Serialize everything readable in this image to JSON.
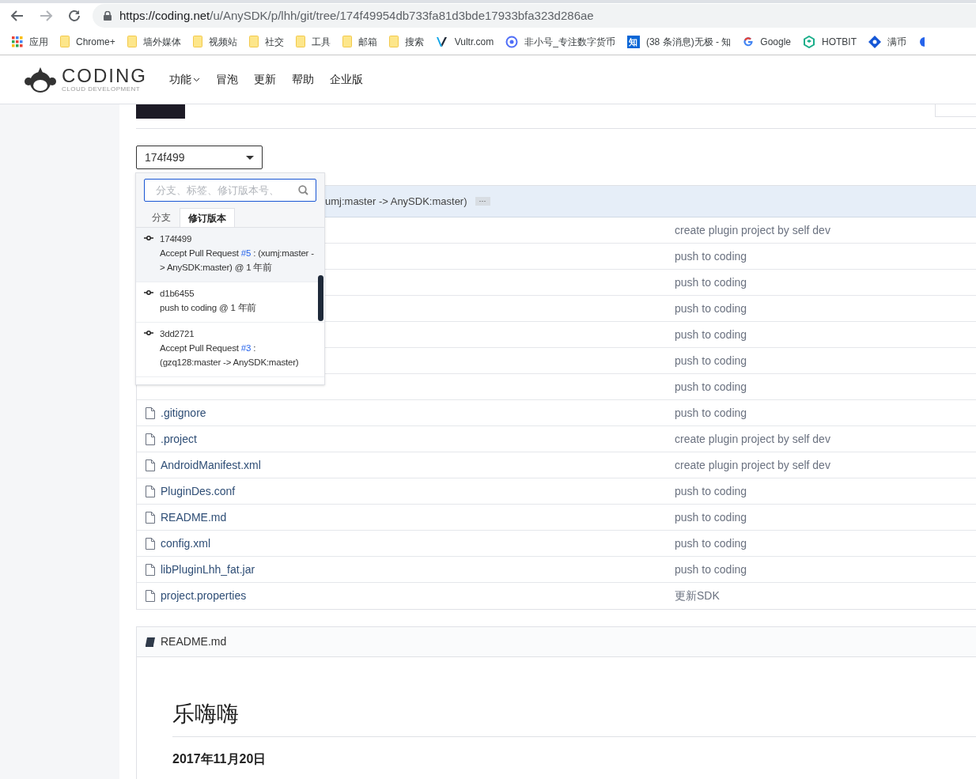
{
  "browser": {
    "url_host": "https://coding.net",
    "url_path": "/u/AnySDK/p/lhh/git/tree/174f49954db733fa81d3bde17933bfa323d286ae",
    "bookmarks": [
      {
        "kind": "apps",
        "label": "应用"
      },
      {
        "kind": "folder",
        "label": "Chrome+"
      },
      {
        "kind": "folder",
        "label": "墙外媒体"
      },
      {
        "kind": "folder",
        "label": "视频站"
      },
      {
        "kind": "folder",
        "label": "社交"
      },
      {
        "kind": "folder",
        "label": "工具"
      },
      {
        "kind": "folder",
        "label": "邮箱"
      },
      {
        "kind": "folder",
        "label": "搜索"
      },
      {
        "kind": "vultr",
        "label": "Vultr.com"
      },
      {
        "kind": "ring",
        "label": "非小号_专注数字货币"
      },
      {
        "kind": "zhihu",
        "glyph": "知",
        "label": "(38 条消息)无极 - 知"
      },
      {
        "kind": "google",
        "label": "Google"
      },
      {
        "kind": "hotbit",
        "label": "HOTBIT"
      },
      {
        "kind": "diamond",
        "label": "满币"
      },
      {
        "kind": "blob"
      }
    ]
  },
  "site": {
    "logo": "CODING",
    "logo_sub": "CLOUD DEVELOPMENT",
    "nav": [
      {
        "label": "功能",
        "menu": true
      },
      {
        "label": "冒泡",
        "menu": false
      },
      {
        "label": "更新",
        "menu": false
      },
      {
        "label": "帮助",
        "menu": false
      },
      {
        "label": "企业版",
        "menu": false
      }
    ]
  },
  "ref_select": {
    "value": "174f499"
  },
  "ref_menu": {
    "placeholder": "分支、标签、修订版本号、",
    "tabs": [
      {
        "label": "分支",
        "selected": false
      },
      {
        "label": "修订版本",
        "selected": true
      }
    ],
    "commits": [
      {
        "hash": "174f499",
        "prefix": "Accept Pull Request ",
        "link": "#5",
        "suffix": " : (xumj:master -> AnySDK:master) @ 1 年前",
        "selected": true
      },
      {
        "hash": "d1b6455",
        "prefix": "push to coding @ 1 年前",
        "selected": false
      },
      {
        "hash": "3dd2721",
        "prefix": "Accept Pull Request ",
        "link": "#3",
        "suffix": " : (gzq128:master -> AnySDK:master)",
        "selected": false
      }
    ]
  },
  "files": {
    "last_commit": "umj:master -> AnySDK:master)",
    "more": "···",
    "rows": [
      {
        "message": "create plugin project by self dev"
      },
      {
        "message": "push to coding"
      },
      {
        "message": "push to coding"
      },
      {
        "message": "push to coding"
      },
      {
        "message": "push to coding"
      },
      {
        "message": "push to coding"
      },
      {
        "message": "push to coding"
      },
      {
        "name": ".gitignore",
        "message": "push to coding"
      },
      {
        "name": ".project",
        "message": "create plugin project by self dev"
      },
      {
        "name": "AndroidManifest.xml",
        "message": "create plugin project by self dev"
      },
      {
        "name": "PluginDes.conf",
        "message": "push to coding"
      },
      {
        "name": "README.md",
        "message": "push to coding"
      },
      {
        "name": "config.xml",
        "message": "push to coding"
      },
      {
        "name": "libPluginLhh_fat.jar",
        "message": "push to coding"
      },
      {
        "name": "project.properties",
        "message": "更新SDK"
      }
    ]
  },
  "readme": {
    "file": "README.md",
    "heading": "乐嗨嗨",
    "date": "2017年11月20日"
  }
}
